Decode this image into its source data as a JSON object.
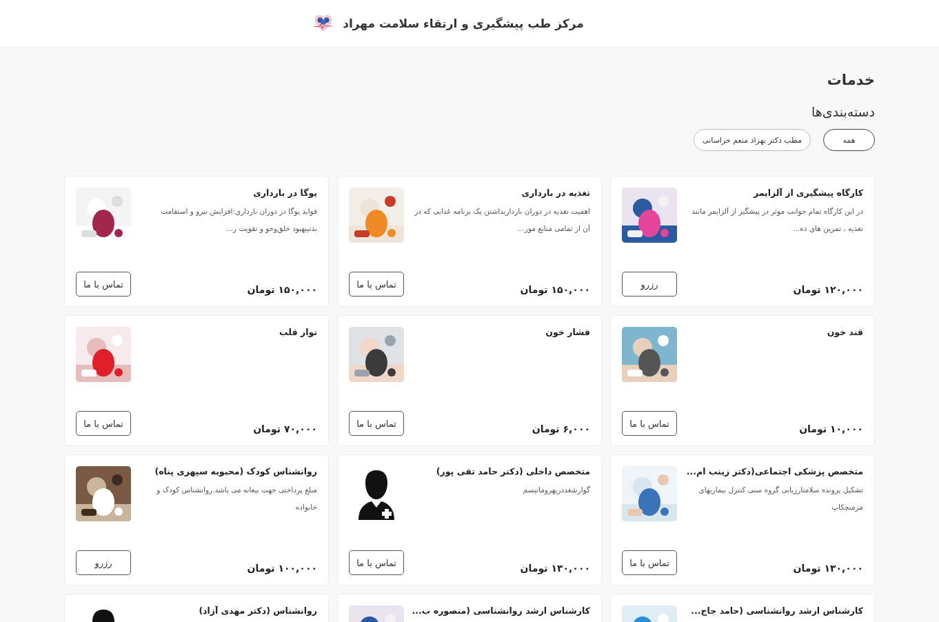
{
  "header": {
    "title": "مرکز طب پیشگیری و ارتقاء سلامت مهراد"
  },
  "section_title": "خدمات",
  "categories": {
    "heading": "دسته‌بندی‌ها",
    "chips": [
      {
        "label": "همه",
        "selected": true
      },
      {
        "label": "مطب دکتر بهزاد منعم خراسانی",
        "selected": false
      }
    ]
  },
  "services": [
    {
      "title": "کارگاه پیشگیری از آلزایمر",
      "description": "در این کارگاه تمام جوانب موثر در پیشگیر از آلزایمر مانند تغذیه ، تمرین های ذه...",
      "price": "۱۲۰,۰۰۰ تومان",
      "button": "رزرو",
      "kind": "picture"
    },
    {
      "title": "تغذیه در بارداری",
      "description": "اهمیت تغذیه در دوران بارداریداشتن یک برنامه غذایی که در آن از تمامی منابع مور...",
      "price": "۱۵۰,۰۰۰ تومان",
      "button": "تماس با ما",
      "kind": "picture"
    },
    {
      "title": "یوگا در بارداری",
      "description": "فواید یوگا در دوران بارداری:افزایش نیرو و استقامت بدنیبهبود خلق‌وخو و تقویت ر...",
      "price": "۱۵۰,۰۰۰ تومان",
      "button": "تماس با ما",
      "kind": "picture"
    },
    {
      "title": "قند خون",
      "price": "۱۰,۰۰۰ تومان",
      "button": "تماس با ما",
      "kind": "picture"
    },
    {
      "title": "فشار خون",
      "price": "۶,۰۰۰ تومان",
      "button": "تماس با ما",
      "kind": "picture"
    },
    {
      "title": "نوار قلب",
      "price": "۷۰,۰۰۰ تومان",
      "button": "تماس با ما",
      "kind": "picture"
    },
    {
      "title": "متخصص پزشکی اجتماعی(دکتر زینب ام...",
      "description": "تشکیل پرونده سلامتارزیابی گروه سنی کنترل بیماریهای مزمنچکاپ",
      "price": "۱۳۰,۰۰۰ تومان",
      "button": "تماس با ما",
      "kind": "picture"
    },
    {
      "title": "متخصص داخلی (دکتر حامد تقی پور)",
      "description": "گوارشغددریهروماتیسم",
      "price": "۱۳۰,۰۰۰ تومان",
      "button": "تماس با ما",
      "kind": "silhouette"
    },
    {
      "title": "روانشناس کودک (محبوبه سپهری پناه)",
      "description": "مبلغ پرداختی جهت بیعانه می باشد.روانشناس کودک و خانواده",
      "price": "۱۰۰,۰۰۰ تومان",
      "button": "رزرو",
      "kind": "picture"
    },
    {
      "title": "کارشناس ارشد روانشناسی (حامد جاج...",
      "kind": "picture"
    },
    {
      "title": "کارشناس ارشد روانشناسی (منصوره ب...",
      "kind": "picture"
    },
    {
      "title": "روانشناس (دکتر مهدی آزاد)",
      "kind": "silhouette"
    }
  ]
}
